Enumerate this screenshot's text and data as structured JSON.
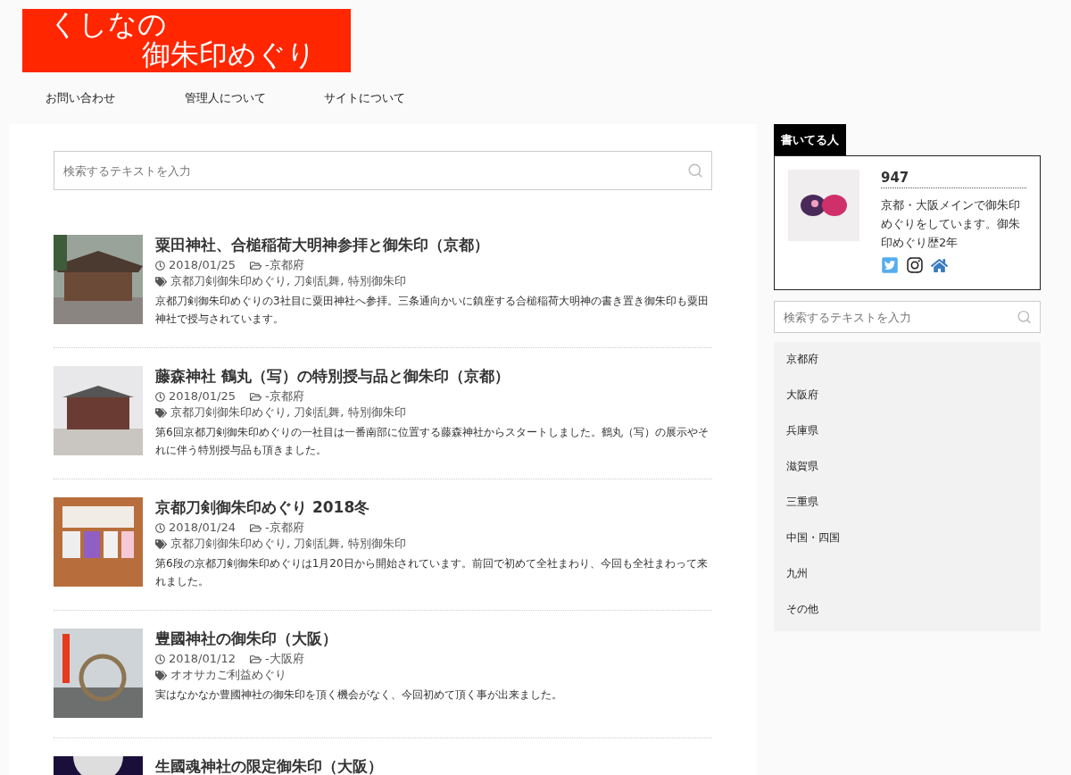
{
  "logo": {
    "lines": [
      "くしなの",
      "御朱印めぐり"
    ]
  },
  "nav": [
    "お問い合わせ",
    "管理人について",
    "サイトについて"
  ],
  "search": {
    "placeholder": "検索するテキストを入力"
  },
  "posts": [
    {
      "title": "粟田神社、合槌稲荷大明神参拝と御朱印（京都）",
      "date": "2018/01/25",
      "category": "-京都府",
      "tags": "京都刀剣御朱印めぐり, 刀剣乱舞, 特別御朱印",
      "excerpt": "京都刀剣御朱印めぐりの3社目に粟田神社へ参拝。三条通向かいに鎮座する合槌稲荷大明神の書き置き御朱印も粟田神社で授与されています。"
    },
    {
      "title": "藤森神社 鶴丸（写）の特別授与品と御朱印（京都）",
      "date": "2018/01/25",
      "category": "-京都府",
      "tags": "京都刀剣御朱印めぐり, 刀剣乱舞, 特別御朱印",
      "excerpt": "第6回京都刀剣御朱印めぐりの一社目は一番南部に位置する藤森神社からスタートしました。鶴丸（写）の展示やそれに伴う特別授与品も頂きました。"
    },
    {
      "title": "京都刀剣御朱印めぐり 2018冬",
      "date": "2018/01/24",
      "category": "-京都府",
      "tags": "京都刀剣御朱印めぐり, 刀剣乱舞, 特別御朱印",
      "excerpt": "第6段の京都刀剣御朱印めぐりは1月20日から開始されています。前回で初めて全社まわり、今回も全社まわって来れました。"
    },
    {
      "title": "豊國神社の御朱印（大阪）",
      "date": "2018/01/12",
      "category": "-大阪府",
      "tags": "オオサカご利益めぐり",
      "excerpt": "実はなかなか豊國神社の御朱印を頂く機会がなく、今回初めて頂く事が出来ました。"
    },
    {
      "title": "生國魂神社の限定御朱印（大阪）"
    }
  ],
  "profile": {
    "heading": "書いてる人",
    "name": "947",
    "bio": "京都・大阪メインで御朱印めぐりをしています。御朱印めぐり歴2年"
  },
  "sidebar_search": {
    "placeholder": "検索するテキストを入力"
  },
  "categories": [
    "京都府",
    "大阪府",
    "兵庫県",
    "滋賀県",
    "三重県",
    "中国・四国",
    "九州",
    "その他"
  ]
}
